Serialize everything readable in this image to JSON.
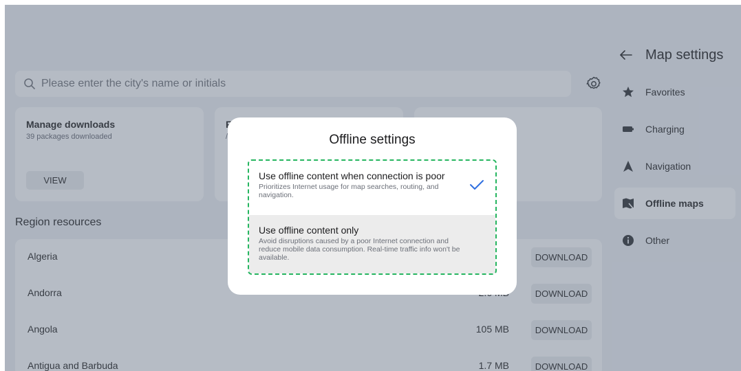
{
  "search": {
    "placeholder": "Please enter the city's name or initials"
  },
  "cards": [
    {
      "title": "Manage downloads",
      "subtitle": "39 packages downloaded",
      "button": "VIEW"
    },
    {
      "title": "F",
      "subtitle": "/"
    },
    {
      "title": "",
      "subtitle": ""
    }
  ],
  "region_title": "Region resources",
  "regions": [
    {
      "name": "Algeria",
      "size": "",
      "action": "DOWNLOAD"
    },
    {
      "name": "Andorra",
      "size": "2.6 MB",
      "action": "DOWNLOAD"
    },
    {
      "name": "Angola",
      "size": "105 MB",
      "action": "DOWNLOAD"
    },
    {
      "name": "Antigua and Barbuda",
      "size": "1.7 MB",
      "action": "DOWNLOAD"
    }
  ],
  "sidebar": {
    "title": "Map settings",
    "items": [
      {
        "label": "Favorites",
        "icon": "star-icon"
      },
      {
        "label": "Charging",
        "icon": "battery-icon"
      },
      {
        "label": "Navigation",
        "icon": "navigation-arrow-icon"
      },
      {
        "label": "Offline maps",
        "icon": "offline-map-icon",
        "selected": true
      },
      {
        "label": "Other",
        "icon": "info-icon"
      }
    ]
  },
  "dialog": {
    "title": "Offline settings",
    "options": [
      {
        "title": "Use offline content when connection is poor",
        "description": "Prioritizes Internet usage for map searches, routing, and navigation.",
        "selected": true
      },
      {
        "title": "Use offline content only",
        "description": "Avoid disruptions caused by a poor Internet connection and reduce mobile data consumption. Real-time traffic info won't be available.",
        "selected": false
      }
    ]
  },
  "colors": {
    "accent": "#2f6fe0",
    "highlight_border": "#25b55f"
  }
}
